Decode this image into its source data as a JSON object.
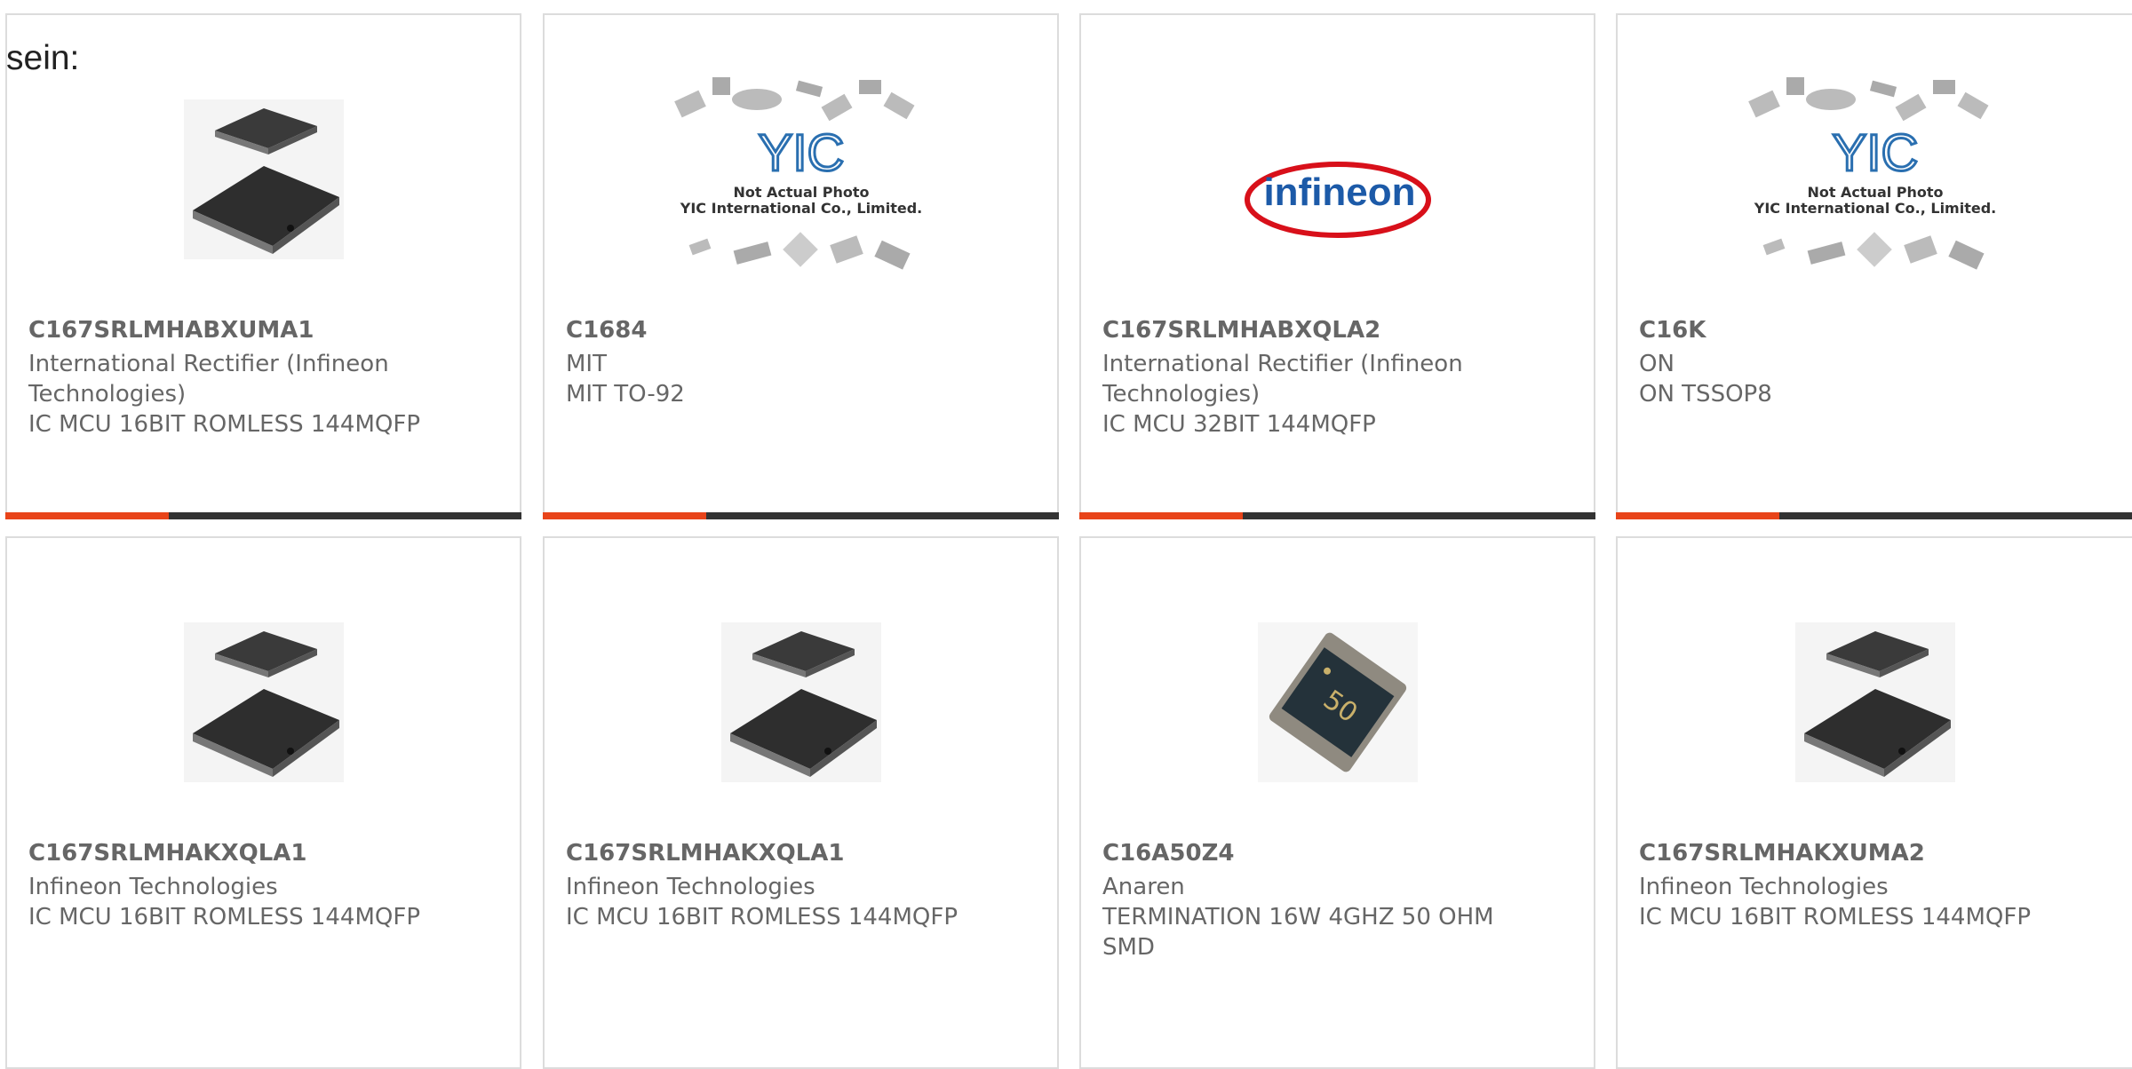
{
  "lead_text": "sein:",
  "cards": [
    {
      "part": "C167SRLMHABXUMA1",
      "manufacturer": "International Rectifier (Infineon Technologies)",
      "description": "IC MCU 16BIT ROMLESS 144MQFP",
      "image": "qfp-chip-icon"
    },
    {
      "part": "C1684",
      "manufacturer": "MIT",
      "description": "MIT TO-92",
      "image": "yic-placeholder",
      "placeholder_line1": "Not Actual Photo",
      "placeholder_line2": "YIC International Co., Limited.",
      "logo_text": "YIC"
    },
    {
      "part": "C167SRLMHABXQLA2",
      "manufacturer": "International Rectifier (Infineon Technologies)",
      "description": "IC MCU 32BIT 144MQFP",
      "image": "infineon-logo",
      "logo_text": "infineon"
    },
    {
      "part": "C16K",
      "manufacturer": "ON",
      "description": "ON TSSOP8",
      "image": "yic-placeholder",
      "placeholder_line1": "Not Actual Photo",
      "placeholder_line2": "YIC International Co., Limited.",
      "logo_text": "YIC"
    },
    {
      "part": "C167SRLMHAKXQLA1",
      "manufacturer": "Infineon Technologies",
      "description": "IC MCU 16BIT ROMLESS 144MQFP",
      "image": "qfp-chip-icon"
    },
    {
      "part": "C167SRLMHAKXQLA1",
      "manufacturer": "Infineon Technologies",
      "description": "IC MCU 16BIT ROMLESS 144MQFP",
      "image": "qfp-chip-icon"
    },
    {
      "part": "C16A50Z4",
      "manufacturer": "Anaren",
      "description": "TERMINATION 16W 4GHZ 50 OHM SMD",
      "image": "termination-chip-icon",
      "chip_text": "50"
    },
    {
      "part": "C167SRLMHAKXUMA2",
      "manufacturer": "Infineon Technologies",
      "description": "IC MCU 16BIT ROMLESS 144MQFP",
      "image": "qfp-chip-icon"
    }
  ],
  "colors": {
    "accent": "#e8441a",
    "bar": "#333333",
    "text": "#666666",
    "border": "#dcdcdc"
  }
}
